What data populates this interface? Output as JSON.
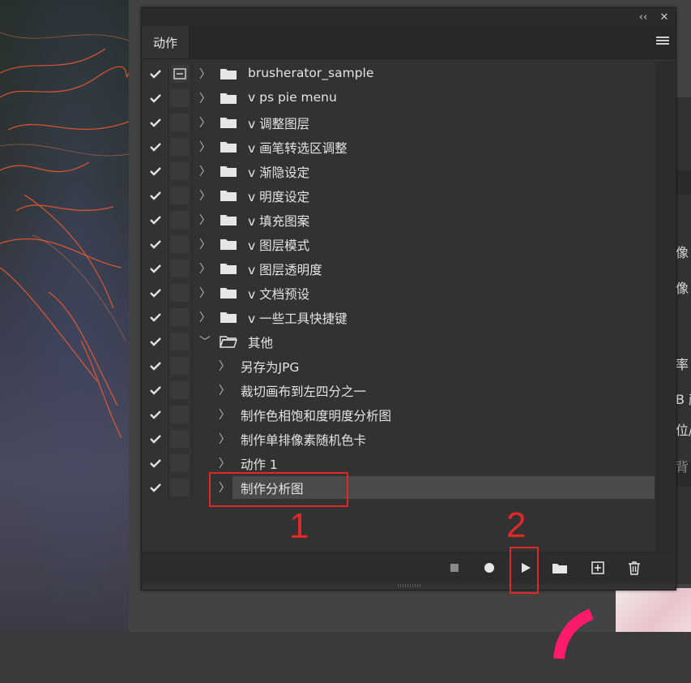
{
  "panel": {
    "tab_label": "动作",
    "collapse_icon": "double-chevron-left-icon",
    "close_icon": "close-icon",
    "menu_icon": "hamburger-icon"
  },
  "actions": [
    {
      "label": "brusherator_sample",
      "type": "set",
      "dialog": true,
      "expanded": false
    },
    {
      "label": "v ps pie menu",
      "type": "set",
      "dialog": false,
      "expanded": false
    },
    {
      "label": "v 调整图层",
      "type": "set",
      "dialog": false,
      "expanded": false
    },
    {
      "label": "v 画笔转选区调整",
      "type": "set",
      "dialog": false,
      "expanded": false
    },
    {
      "label": "v 渐隐设定",
      "type": "set",
      "dialog": false,
      "expanded": false
    },
    {
      "label": "v 明度设定",
      "type": "set",
      "dialog": false,
      "expanded": false
    },
    {
      "label": "v 填充图案",
      "type": "set",
      "dialog": false,
      "expanded": false
    },
    {
      "label": "v 图层模式",
      "type": "set",
      "dialog": false,
      "expanded": false
    },
    {
      "label": "v 图层透明度",
      "type": "set",
      "dialog": false,
      "expanded": false
    },
    {
      "label": "v 文档预设",
      "type": "set",
      "dialog": false,
      "expanded": false
    },
    {
      "label": "v 一些工具快捷键",
      "type": "set",
      "dialog": false,
      "expanded": false
    },
    {
      "label": "其他",
      "type": "set",
      "dialog": false,
      "expanded": true
    },
    {
      "label": "另存为JPG",
      "type": "action",
      "dialog": false,
      "expanded": false
    },
    {
      "label": "裁切画布到左四分之一",
      "type": "action",
      "dialog": false,
      "expanded": false
    },
    {
      "label": "制作色相饱和度明度分析图",
      "type": "action",
      "dialog": false,
      "expanded": false
    },
    {
      "label": "制作单排像素随机色卡",
      "type": "action",
      "dialog": false,
      "expanded": false
    },
    {
      "label": "动作 1",
      "type": "action",
      "dialog": false,
      "expanded": false
    },
    {
      "label": "制作分析图",
      "type": "action",
      "dialog": false,
      "expanded": false,
      "selected": true
    }
  ],
  "toolbar": {
    "stop": "stop-icon",
    "record": "record-icon",
    "play": "play-icon",
    "new_set": "folder-icon",
    "new_action": "new-item-icon",
    "delete": "trash-icon"
  },
  "annotations": {
    "one": "1",
    "two": "2",
    "color": "#e02828"
  },
  "background_fragments": [
    "像",
    "像",
    "率",
    "B 颜",
    "位/",
    "背"
  ]
}
